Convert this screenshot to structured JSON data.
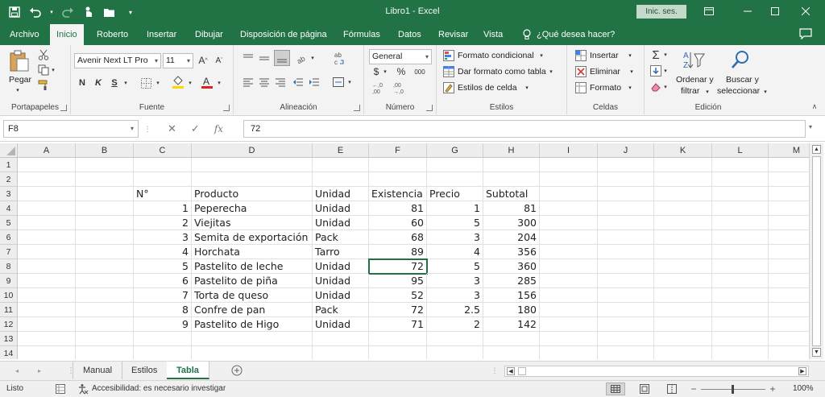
{
  "titlebar": {
    "title": "Libro1  -  Excel",
    "signin_label": "Inic. ses."
  },
  "tabs": [
    {
      "label": "Archivo",
      "active": false
    },
    {
      "label": "Inicio",
      "active": true
    },
    {
      "label": "Roberto",
      "active": false
    },
    {
      "label": "Insertar",
      "active": false
    },
    {
      "label": "Dibujar",
      "active": false
    },
    {
      "label": "Disposición de página",
      "active": false
    },
    {
      "label": "Fórmulas",
      "active": false
    },
    {
      "label": "Datos",
      "active": false
    },
    {
      "label": "Revisar",
      "active": false
    },
    {
      "label": "Vista",
      "active": false
    }
  ],
  "tellme": "¿Qué desea hacer?",
  "ribbon": {
    "clipboard": {
      "paste_label": "Pegar",
      "group_label": "Portapapeles"
    },
    "font": {
      "font_name": "Avenir Next LT Pro",
      "font_size": "11",
      "bold": "N",
      "italic": "K",
      "underline": "S",
      "group_label": "Fuente"
    },
    "alignment": {
      "group_label": "Alineación"
    },
    "number": {
      "format": "General",
      "currency": "$",
      "percent": "%",
      "thousands": "000",
      "group_label": "Número"
    },
    "styles": {
      "conditional": "Formato condicional",
      "as_table": "Dar formato como tabla",
      "cell_styles": "Estilos de celda",
      "group_label": "Estilos"
    },
    "cells": {
      "insert": "Insertar",
      "delete": "Eliminar",
      "format": "Formato",
      "group_label": "Celdas"
    },
    "editing": {
      "sort_line1": "Ordenar y",
      "sort_line2": "filtrar",
      "find_line1": "Buscar y",
      "find_line2": "seleccionar",
      "group_label": "Edición"
    }
  },
  "formula_bar": {
    "name_box": "F8",
    "fx": "fx",
    "value": "72"
  },
  "columns": [
    "A",
    "B",
    "C",
    "D",
    "E",
    "F",
    "G",
    "H",
    "I",
    "J",
    "K",
    "L",
    "M"
  ],
  "rows": [
    "1",
    "2",
    "3",
    "4",
    "5",
    "6",
    "7",
    "8",
    "9",
    "10",
    "11",
    "12",
    "13",
    "14"
  ],
  "table": {
    "headers": {
      "no": "N°",
      "product": "Producto",
      "unit": "Unidad",
      "stock": "Existencia",
      "price": "Precio",
      "subtotal": "Subtotal"
    },
    "rows": [
      {
        "no": "1",
        "product": "Peperecha",
        "unit": "Unidad",
        "stock": "81",
        "price": "1",
        "subtotal": "81"
      },
      {
        "no": "2",
        "product": "Viejitas",
        "unit": "Unidad",
        "stock": "60",
        "price": "5",
        "subtotal": "300"
      },
      {
        "no": "3",
        "product": "Semita de exportación",
        "unit": "Pack",
        "stock": "68",
        "price": "3",
        "subtotal": "204"
      },
      {
        "no": "4",
        "product": "Horchata",
        "unit": "Tarro",
        "stock": "89",
        "price": "4",
        "subtotal": "356"
      },
      {
        "no": "5",
        "product": "Pastelito de leche",
        "unit": "Unidad",
        "stock": "72",
        "price": "5",
        "subtotal": "360"
      },
      {
        "no": "6",
        "product": "Pastelito de piña",
        "unit": "Unidad",
        "stock": "95",
        "price": "3",
        "subtotal": "285"
      },
      {
        "no": "7",
        "product": "Torta de queso",
        "unit": "Unidad",
        "stock": "52",
        "price": "3",
        "subtotal": "156"
      },
      {
        "no": "8",
        "product": "Confre de pan",
        "unit": "Pack",
        "stock": "72",
        "price": "2.5",
        "subtotal": "180"
      },
      {
        "no": "9",
        "product": "Pastelito de Higo",
        "unit": "Unidad",
        "stock": "71",
        "price": "2",
        "subtotal": "142"
      }
    ]
  },
  "sheets": [
    {
      "label": "Manual",
      "active": false
    },
    {
      "label": "Estilos",
      "active": false
    },
    {
      "label": "Tabla",
      "active": true
    }
  ],
  "status": {
    "ready": "Listo",
    "accessibility": "Accesibilidad: es necesario investigar",
    "zoom": "100%"
  },
  "colors": {
    "brand": "#217346"
  }
}
